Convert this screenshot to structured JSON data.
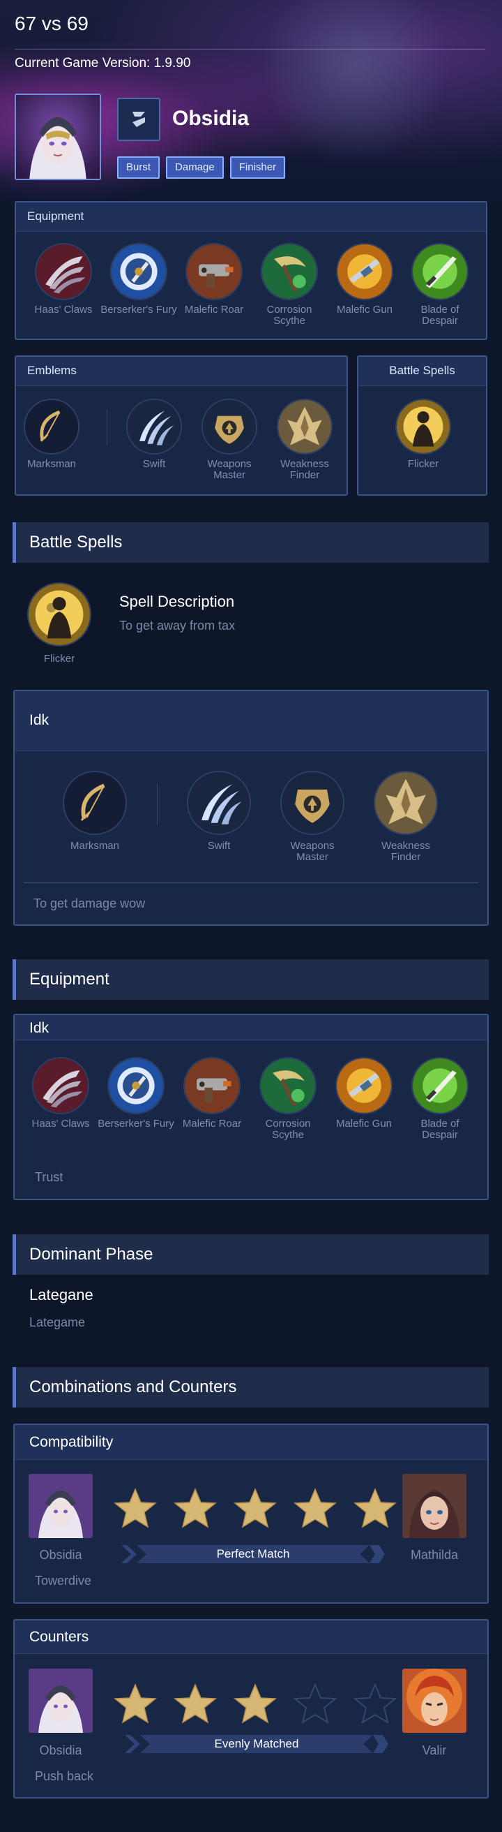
{
  "header": {
    "match_title": "67 vs 69",
    "game_version": "Current Game Version: 1.9.90",
    "hero_name": "Obsidia",
    "roles": [
      "Burst",
      "Damage",
      "Finisher"
    ]
  },
  "equipment_panel": {
    "title": "Equipment",
    "items": [
      "Haas' Claws",
      "Berserker's Fury",
      "Malefic Roar",
      "Corrosion Scythe",
      "Malefic Gun",
      "Blade of Despair"
    ]
  },
  "emblems_panel": {
    "title": "Emblems",
    "main": "Marksman",
    "talents": [
      "Swift",
      "Weapons Master",
      "Weakness Finder"
    ]
  },
  "battle_spells_panel": {
    "title": "Battle Spells",
    "spell": "Flicker"
  },
  "battle_spells_section": {
    "title": "Battle Spells",
    "spell": "Flicker",
    "desc_title": "Spell Description",
    "desc_text": "To get away from tax"
  },
  "emblem_build": {
    "title": "Idk",
    "main": "Marksman",
    "talents": [
      "Swift",
      "Weapons Master",
      "Weakness Finder"
    ],
    "note": "To get damage wow"
  },
  "equipment_section": {
    "title": "Equipment",
    "build_title": "Idk",
    "items": [
      "Haas' Claws",
      "Berserker's Fury",
      "Malefic Roar",
      "Corrosion Scythe",
      "Malefic Gun",
      "Blade of Despair"
    ],
    "note": "Trust"
  },
  "dominant_phase": {
    "title": "Dominant Phase",
    "phase": "Lategane",
    "note": "Lategame"
  },
  "combos": {
    "title": "Combinations and Counters",
    "compatibility": {
      "title": "Compatibility",
      "hero_left": "Obsidia",
      "hero_right": "Mathilda",
      "rating": 5,
      "rating_max": 5,
      "rating_label": "Perfect Match",
      "note": "Towerdive"
    },
    "counters": {
      "title": "Counters",
      "hero_left": "Obsidia",
      "hero_right": "Valir",
      "rating": 3,
      "rating_max": 5,
      "rating_label": "Evenly Matched",
      "note": "Push back"
    }
  },
  "colors": {
    "background": "#0e1629",
    "panel": "#192746",
    "panel_border": "#3a5486",
    "accent": "#5a76c6",
    "badge": "#3c58b5",
    "star_gold": "#d7b774"
  },
  "icons": [
    "assassin-role-icon",
    "haas-claws-icon",
    "berserkers-fury-icon",
    "malefic-roar-icon",
    "corrosion-scythe-icon",
    "malefic-gun-icon",
    "blade-of-despair-icon",
    "marksman-emblem-icon",
    "swift-talent-icon",
    "weapons-master-talent-icon",
    "weakness-finder-talent-icon",
    "flicker-spell-icon",
    "star-icon"
  ]
}
